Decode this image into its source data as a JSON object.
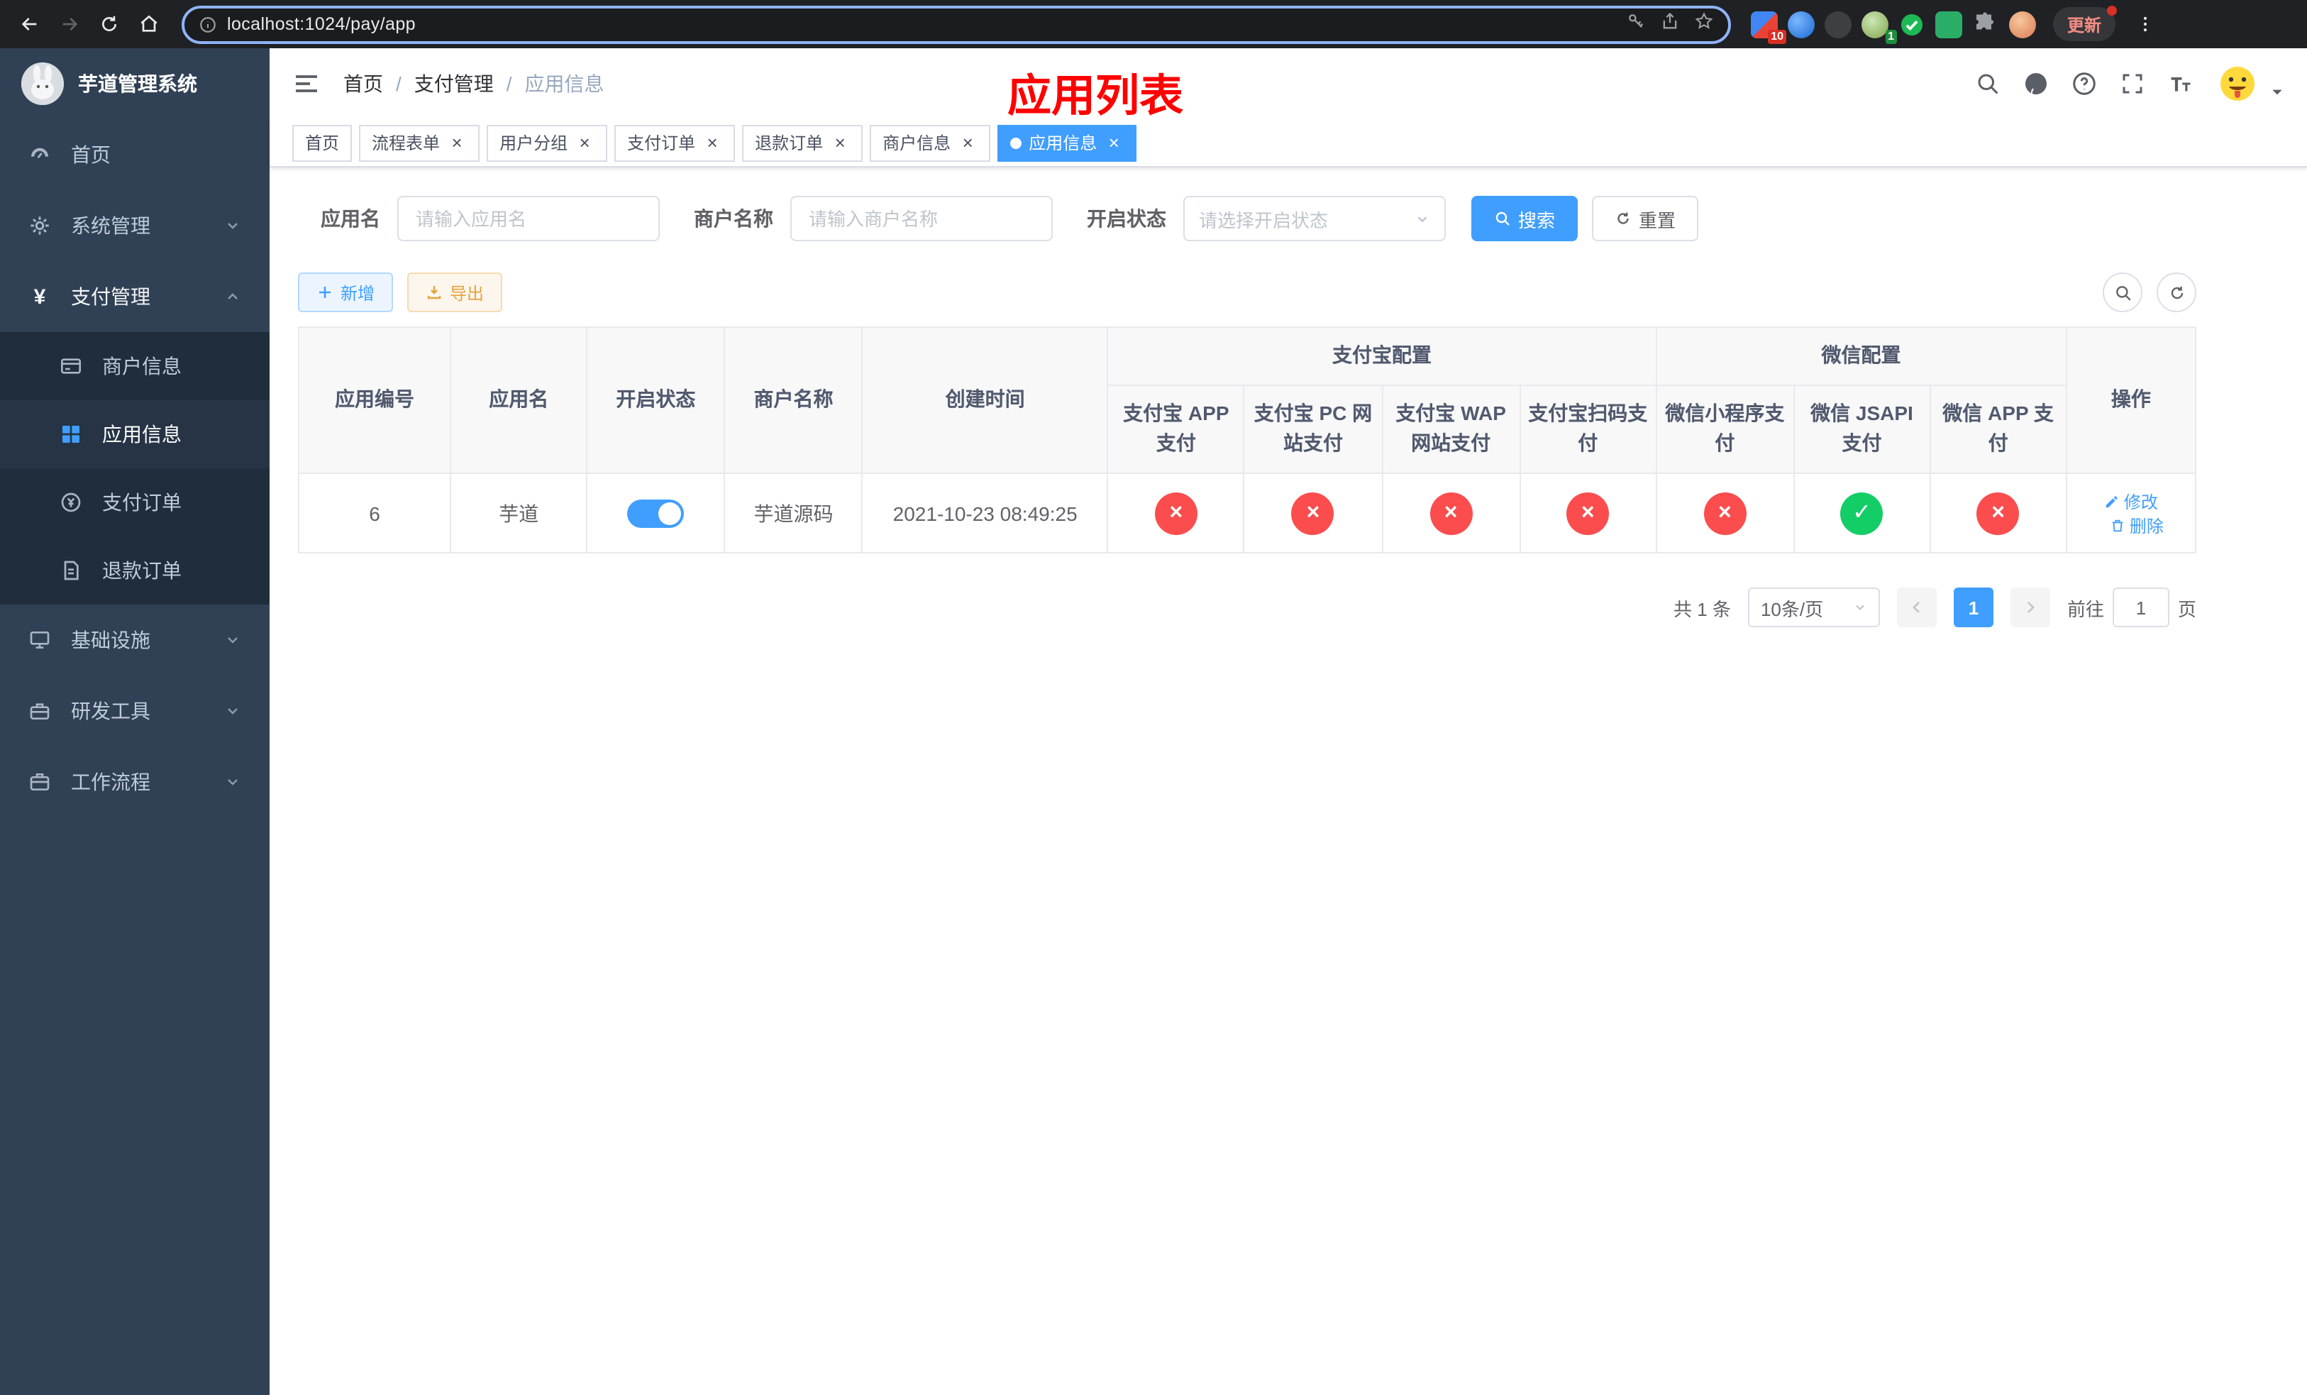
{
  "browser": {
    "url": "localhost:1024/pay/app",
    "update_label": "更新",
    "extension_badge": "10",
    "profile_badge": "1"
  },
  "sidebar": {
    "logo_title": "芋道管理系统",
    "items": [
      {
        "label": "首页"
      },
      {
        "label": "系统管理"
      },
      {
        "label": "支付管理"
      },
      {
        "label": "基础设施"
      },
      {
        "label": "研发工具"
      },
      {
        "label": "工作流程"
      }
    ],
    "payment_submenu": [
      {
        "label": "商户信息"
      },
      {
        "label": "应用信息"
      },
      {
        "label": "支付订单"
      },
      {
        "label": "退款订单"
      }
    ]
  },
  "header": {
    "breadcrumb": [
      "首页",
      "支付管理",
      "应用信息"
    ],
    "banner": "应用列表"
  },
  "tabs": [
    {
      "label": "首页"
    },
    {
      "label": "流程表单"
    },
    {
      "label": "用户分组"
    },
    {
      "label": "支付订单"
    },
    {
      "label": "退款订单"
    },
    {
      "label": "商户信息"
    },
    {
      "label": "应用信息"
    }
  ],
  "filters": {
    "app_name_label": "应用名",
    "app_name_placeholder": "请输入应用名",
    "merchant_label": "商户名称",
    "merchant_placeholder": "请输入商户名称",
    "status_label": "开启状态",
    "status_placeholder": "请选择开启状态",
    "search": "搜索",
    "reset": "重置"
  },
  "toolbar": {
    "add": "新增",
    "export": "导出"
  },
  "table": {
    "groups": {
      "alipay": "支付宝配置",
      "wechat": "微信配置"
    },
    "columns": {
      "app_id": "应用编号",
      "app_name": "应用名",
      "status": "开启状态",
      "merchant": "商户名称",
      "create_time": "创建时间",
      "alipay_app": "支付宝 APP 支付",
      "alipay_pc": "支付宝 PC 网站支付",
      "alipay_wap": "支付宝 WAP 网站支付",
      "alipay_qr": "支付宝扫码支付",
      "wechat_lite": "微信小程序支付",
      "wechat_jsapi": "微信 JSAPI 支付",
      "wechat_app": "微信 APP 支付",
      "actions": "操作"
    },
    "rows": [
      {
        "app_id": "6",
        "app_name": "芋道",
        "status_on": true,
        "merchant": "芋道源码",
        "create_time": "2021-10-23 08:49:25",
        "alipay_app": "cross",
        "alipay_pc": "cross",
        "alipay_wap": "cross",
        "alipay_qr": "cross",
        "wechat_lite": "cross",
        "wechat_jsapi": "check",
        "wechat_app": "cross"
      }
    ],
    "actions": {
      "edit": "修改",
      "delete": "删除"
    }
  },
  "pagination": {
    "total": "共 1 条",
    "page_size": "10条/页",
    "current_page": "1",
    "goto_label": "前往",
    "goto_value": "1",
    "goto_suffix": "页"
  },
  "icons": {
    "check": "✓",
    "cross": "×"
  }
}
